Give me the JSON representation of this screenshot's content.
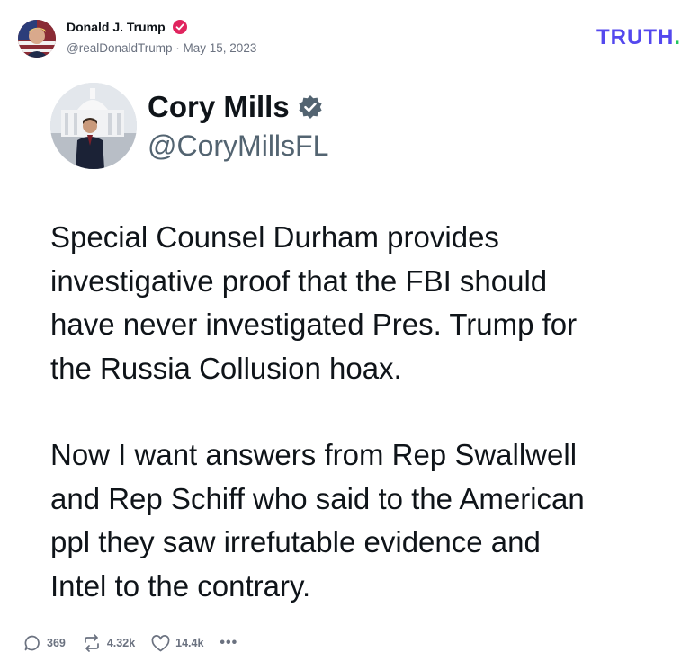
{
  "post": {
    "author_name": "Donald J. Trump",
    "author_handle": "@realDonaldTrump",
    "separator": "·",
    "date": "May 15, 2023"
  },
  "brand": {
    "text": "TRUTH",
    "dot": ".",
    "color": "#5448ee",
    "dot_color": "#22c55e"
  },
  "embed": {
    "name": "Cory Mills",
    "handle": "@CoryMillsFL",
    "paragraphs": [
      "Special Counsel Durham provides\ninvestigative proof that the FBI should\nhave never investigated Pres. Trump for\nthe Russia Collusion hoax.",
      "Now I want answers from Rep Swallwell\nand Rep Schiff who said to the American\nppl they saw irrefutable evidence and\nIntel to the contrary."
    ]
  },
  "actions": {
    "replies": "369",
    "reposts": "4.32k",
    "likes": "14.4k",
    "more": "•••"
  },
  "icons": [
    "verified-badge-icon",
    "reply-icon",
    "repost-icon",
    "like-icon",
    "more-icon"
  ],
  "colors": {
    "verified_red": "#e0245e",
    "verified_gray": "#536471"
  }
}
